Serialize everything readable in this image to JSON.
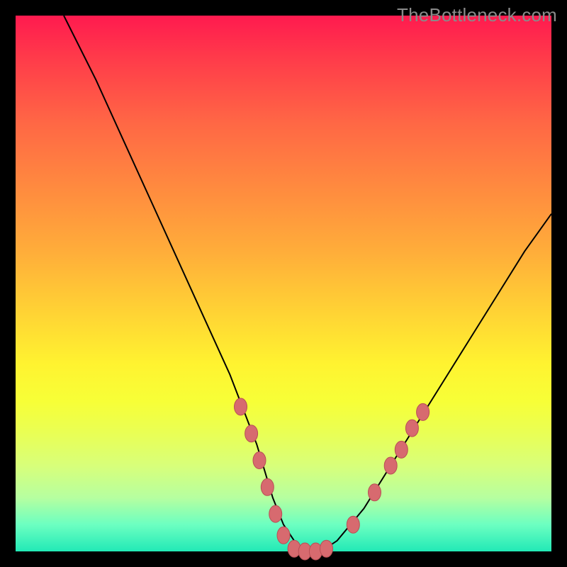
{
  "watermark": "TheBottleneck.com",
  "colors": {
    "background": "#000000",
    "curve_stroke": "#000000",
    "dot_fill": "#d76a6f",
    "dot_stroke": "#b84f55",
    "gradient_top": "#ff1a4f",
    "gradient_bottom": "#22e9b6"
  },
  "chart_data": {
    "type": "line",
    "title": "",
    "xlabel": "",
    "ylabel": "",
    "xlim": [
      0,
      100
    ],
    "ylim": [
      0,
      100
    ],
    "grid": false,
    "legend": false,
    "series": [
      {
        "name": "bottleneck-curve",
        "x": [
          9,
          15,
          20,
          25,
          30,
          35,
          40,
          45,
          48,
          50,
          52,
          54,
          55,
          57,
          60,
          65,
          70,
          75,
          80,
          85,
          90,
          95,
          100
        ],
        "y": [
          100,
          88,
          77,
          66,
          55,
          44,
          33,
          20,
          10,
          5,
          2,
          0,
          0,
          0,
          2,
          8,
          16,
          24,
          32,
          40,
          48,
          56,
          63
        ]
      }
    ],
    "markers": [
      {
        "x": 42,
        "y": 27
      },
      {
        "x": 44,
        "y": 22
      },
      {
        "x": 45.5,
        "y": 17
      },
      {
        "x": 47,
        "y": 12
      },
      {
        "x": 48.5,
        "y": 7
      },
      {
        "x": 50,
        "y": 3
      },
      {
        "x": 52,
        "y": 0.5
      },
      {
        "x": 54,
        "y": 0
      },
      {
        "x": 56,
        "y": 0
      },
      {
        "x": 58,
        "y": 0.5
      },
      {
        "x": 63,
        "y": 5
      },
      {
        "x": 67,
        "y": 11
      },
      {
        "x": 70,
        "y": 16
      },
      {
        "x": 72,
        "y": 19
      },
      {
        "x": 74,
        "y": 23
      },
      {
        "x": 76,
        "y": 26
      }
    ]
  }
}
